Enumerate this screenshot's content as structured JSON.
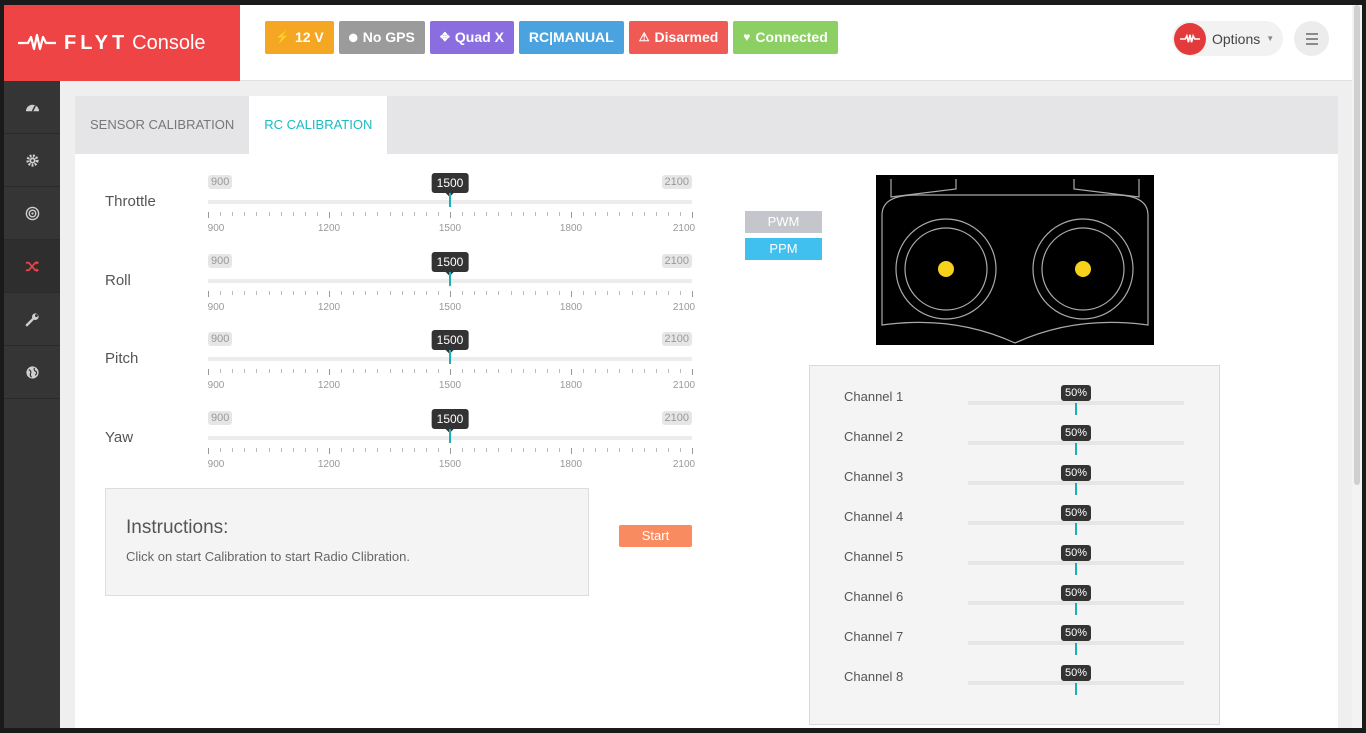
{
  "header": {
    "logo_text": "FLYT",
    "logo_sub": "Console",
    "badges": [
      {
        "icon": "bolt-icon",
        "label": "12 V",
        "color": "#f5a623"
      },
      {
        "icon": "map-marker-icon",
        "label": "No GPS",
        "color": "#9b9b9b"
      },
      {
        "icon": "arrows-icon",
        "label": "Quad X",
        "color": "#8a6ee0"
      },
      {
        "icon": "",
        "label": "RC|MANUAL",
        "color": "#4aa3df"
      },
      {
        "icon": "warning-icon",
        "label": "Disarmed",
        "color": "#ef5a55"
      },
      {
        "icon": "heart-icon",
        "label": "Connected",
        "color": "#8ccf63"
      }
    ],
    "options_label": "Options"
  },
  "sidebar": {
    "items": [
      {
        "icon": "dashboard-icon",
        "active": false
      },
      {
        "icon": "gear-icon",
        "active": false
      },
      {
        "icon": "target-icon",
        "active": false
      },
      {
        "icon": "shuffle-icon",
        "active": true
      },
      {
        "icon": "wrench-icon",
        "active": false
      },
      {
        "icon": "globe-icon",
        "active": false
      }
    ]
  },
  "tabs": [
    {
      "label": "SENSOR CALIBRATION",
      "active": false
    },
    {
      "label": "RC CALIBRATION",
      "active": true
    }
  ],
  "rc_sliders": [
    {
      "label": "Throttle",
      "min": 900,
      "max": 2100,
      "value": 1500
    },
    {
      "label": "Roll",
      "min": 900,
      "max": 2100,
      "value": 1500
    },
    {
      "label": "Pitch",
      "min": 900,
      "max": 2100,
      "value": 1500
    },
    {
      "label": "Yaw",
      "min": 900,
      "max": 2100,
      "value": 1500
    }
  ],
  "tick_labels": [
    "900",
    "1200",
    "1500",
    "1800",
    "2100"
  ],
  "instructions": {
    "title": "Instructions:",
    "text": "Click on start Calibration to start Radio Clibration."
  },
  "start_label": "Start",
  "modes": {
    "pwm": "PWM",
    "ppm": "PPM"
  },
  "channels": [
    {
      "label": "Channel 1",
      "value": 50
    },
    {
      "label": "Channel 2",
      "value": 50
    },
    {
      "label": "Channel 3",
      "value": 50
    },
    {
      "label": "Channel 4",
      "value": 50
    },
    {
      "label": "Channel 5",
      "value": 50
    },
    {
      "label": "Channel 6",
      "value": 50
    },
    {
      "label": "Channel 7",
      "value": 50
    },
    {
      "label": "Channel 8",
      "value": 50
    }
  ]
}
